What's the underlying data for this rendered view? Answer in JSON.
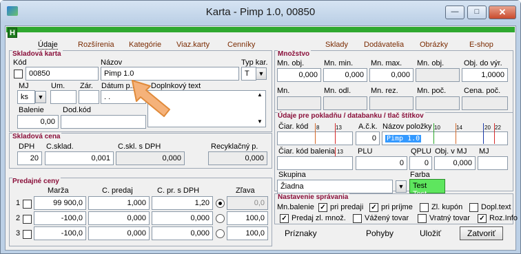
{
  "window": {
    "title": "Karta - Pimp 1.0, 00850",
    "min": "—",
    "max": "□",
    "close": "✕"
  },
  "toolbar": {
    "h_label": "H"
  },
  "tabs": [
    {
      "label": "Údaje"
    },
    {
      "label": "Rozšírenia"
    },
    {
      "label": "Kategórie"
    },
    {
      "label": "Viaz.karty"
    },
    {
      "label": "Cenníky"
    },
    {
      "label": "Sklady"
    },
    {
      "label": "Dodávatelia"
    },
    {
      "label": "Obrázky"
    },
    {
      "label": "E-shop"
    }
  ],
  "card": {
    "section": "Skladová karta",
    "kod_label": "Kód",
    "kod": "00850",
    "nazov_label": "Názov",
    "nazov": "Pimp 1.0",
    "typ_label": "Typ kar.",
    "typ": "T",
    "mj_label": "MJ",
    "mj": "ks",
    "um_label": "Um.",
    "zar_label": "Zár.",
    "datum_label": "Dátum p...h",
    "datum": ". .",
    "dopl_label": "Doplnkový text",
    "balenie_label": "Balenie",
    "balenie": "0,00",
    "dodkod_label": "Dod.kód"
  },
  "price": {
    "section": "Skladová cena",
    "dph_label": "DPH",
    "dph": "20",
    "csklad_label": "C.sklad.",
    "csklad": "0,001",
    "cskldph_label": "C.skl. s DPH",
    "cskldph": "0,000",
    "recykl_label": "Recyklačný p.",
    "recykl": "0,000"
  },
  "sales": {
    "section": "Predajné ceny",
    "h_marza": "Marža",
    "h_cpredaj": "C. predaj",
    "h_cpr": "C. pr. s DPH",
    "h_zlava": "Zľava",
    "rows": [
      {
        "n": "1",
        "marza": "99 900,0",
        "cpredaj": "1,000",
        "cpr": "1,20",
        "zlava": "0,0"
      },
      {
        "n": "2",
        "marza": "-100,0",
        "cpredaj": "0,000",
        "cpr": "0,000",
        "zlava": "100,0"
      },
      {
        "n": "3",
        "marza": "-100,0",
        "cpredaj": "0,000",
        "cpr": "0,000",
        "zlava": "100,0"
      }
    ]
  },
  "qty": {
    "section": "Množstvo",
    "mn_obj_label": "Mn. obj.",
    "mn_obj": "0,000",
    "mn_min_label": "Mn. min.",
    "mn_min": "0,000",
    "mn_max_label": "Mn. max.",
    "mn_max": "0,000",
    "mn_obj2_label": "Mn. obj.",
    "obj_vyr_label": "Obj. do výr.",
    "obj_vyr": "1,0000",
    "mn_label": "Mn.",
    "mn_odl_label": "Mn. odl.",
    "mn_rez_label": "Mn. rez.",
    "mn_poc_label": "Mn. poč.",
    "cena_poc_label": "Cena. poč."
  },
  "pos": {
    "section": "Údaje pre pokladňu / databanku / tlač štítkov",
    "ciar_label": "Čiar. kód",
    "ack_label": "A.č.k.",
    "ack": "0",
    "naz_pol_label": "Názov položky",
    "naz_pol": "Pimp 1.0",
    "ruler_marks": [
      "8",
      "13",
      "10",
      "14",
      "20",
      "22"
    ],
    "ruler2_mark": "13",
    "ciar_bal_label": "Čiar. kód balenia",
    "plu_label": "PLU",
    "plu": "0",
    "qplu_label": "QPLU",
    "qplu": "0",
    "objmj_label": "Obj. v MJ",
    "objmj": "0,000",
    "mj_label": "MJ",
    "skupina_label": "Skupina",
    "skupina": "Žiadna",
    "farba_label": "Farba",
    "farba": "Test",
    "farba2": "Test"
  },
  "settings": {
    "section": "Nastavenie správania",
    "mn_bal_label": "Mn.balenie",
    "pri_predaji": "pri predaji",
    "pri_prijme": "pri príjme",
    "zl_kupon": "Zl. kupón",
    "dopl_text": "Dopl.text",
    "predaj_zl": "Predaj zl. množ.",
    "vazeny": "Vážený tovar",
    "vratny": "Vratný tovar",
    "roz_info": "Roz.Info"
  },
  "actions": {
    "priznaky": "Príznaky",
    "pohyby": "Pohyby",
    "ulozit": "Uložiť",
    "zatvorit": "Zatvoriť"
  },
  "colors": {
    "green": "#2fa82f",
    "accent": "#8a0f3a",
    "highlight": "#3399ff",
    "farba_bg": "#5ee65e"
  }
}
